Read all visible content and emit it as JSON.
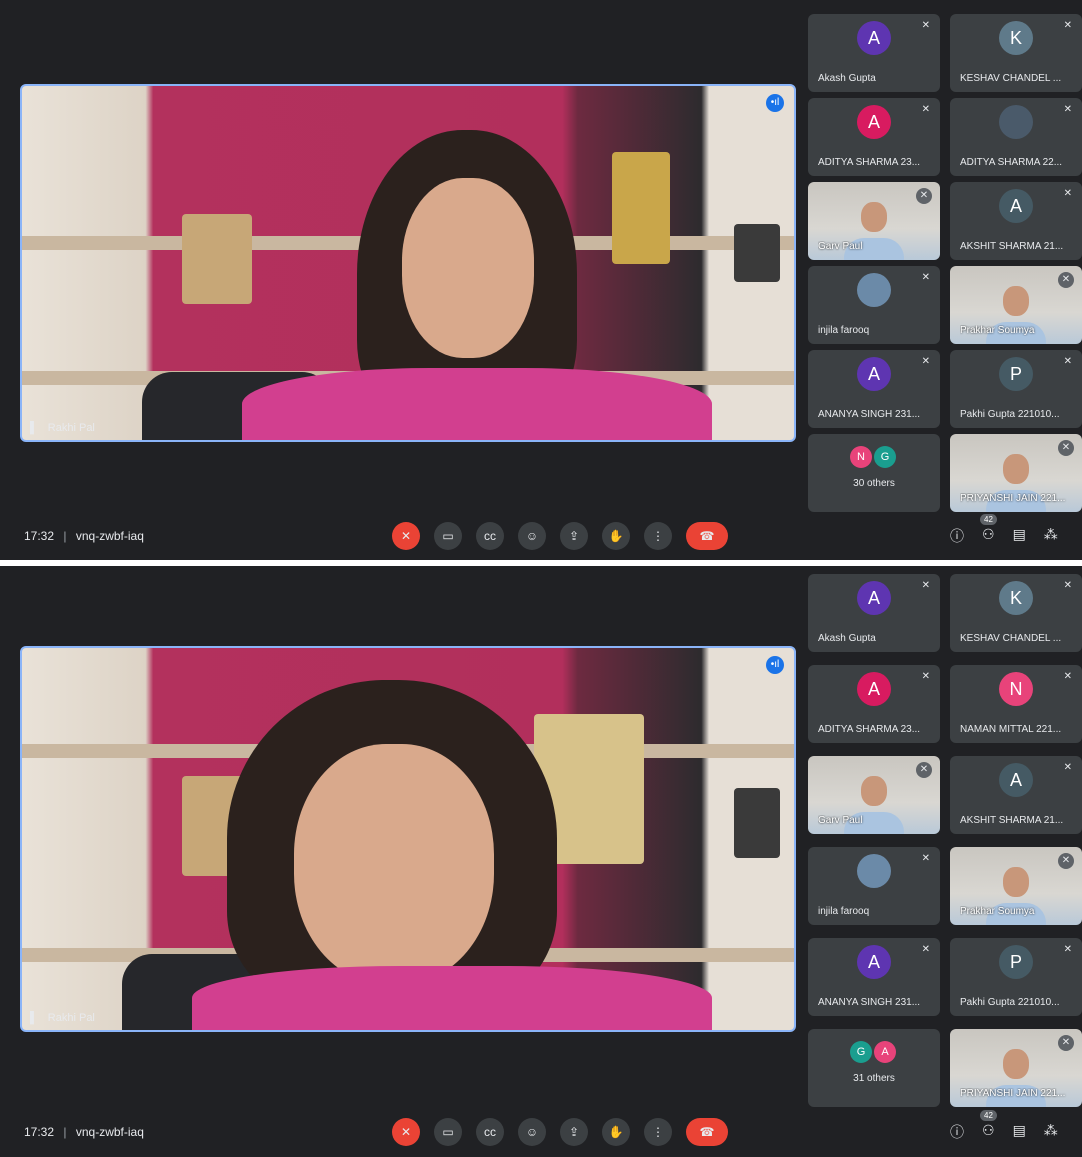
{
  "panels": [
    {
      "main": {
        "name": "Rakhi Pal"
      },
      "meeting": {
        "time": "17:32",
        "separator": "|",
        "code": "vnq-zwbf-iaq"
      },
      "participants_count": "42",
      "tiles": [
        {
          "name": "Akash Gupta",
          "initial": "A",
          "color": "#5e35b1",
          "type": "avatar"
        },
        {
          "name": "KESHAV CHANDEL ...",
          "initial": "K",
          "color": "#5f7a8a",
          "type": "avatar"
        },
        {
          "name": "ADITYA SHARMA 23...",
          "initial": "A",
          "color": "#d81b60",
          "type": "avatar"
        },
        {
          "name": "ADITYA SHARMA 22...",
          "initial": "",
          "color": "#4a5a6a",
          "type": "photo"
        },
        {
          "name": "Garv Paul",
          "initial": "",
          "color": "",
          "type": "video"
        },
        {
          "name": "AKSHIT SHARMA 21...",
          "initial": "A",
          "color": "#455a64",
          "type": "avatar"
        },
        {
          "name": "injila farooq",
          "initial": "",
          "color": "#6b8aa8",
          "type": "photo"
        },
        {
          "name": "Prakhar Soumya",
          "initial": "",
          "color": "",
          "type": "video"
        },
        {
          "name": "ANANYA SINGH 231...",
          "initial": "A",
          "color": "#5e35b1",
          "type": "avatar"
        },
        {
          "name": "Pakhi Gupta 221010...",
          "initial": "P",
          "color": "#455a64",
          "type": "avatar"
        },
        {
          "name": "30 others",
          "initial": "",
          "color": "",
          "type": "others",
          "m1": "N",
          "m1c": "#e8437a",
          "m2": "G",
          "m2c": "#1a9e8f"
        },
        {
          "name": "PRIYANSHI JAIN 221...",
          "initial": "",
          "color": "",
          "type": "video"
        }
      ]
    },
    {
      "main": {
        "name": "Rakhi Pal"
      },
      "meeting": {
        "time": "17:32",
        "separator": "|",
        "code": "vnq-zwbf-iaq"
      },
      "participants_count": "42",
      "tiles": [
        {
          "name": "Akash Gupta",
          "initial": "A",
          "color": "#5e35b1",
          "type": "avatar"
        },
        {
          "name": "KESHAV CHANDEL ...",
          "initial": "K",
          "color": "#5f7a8a",
          "type": "avatar"
        },
        {
          "name": "ADITYA SHARMA 23...",
          "initial": "A",
          "color": "#d81b60",
          "type": "avatar"
        },
        {
          "name": "NAMAN MITTAL 221...",
          "initial": "N",
          "color": "#e8437a",
          "type": "avatar"
        },
        {
          "name": "Garv Paul",
          "initial": "",
          "color": "",
          "type": "video"
        },
        {
          "name": "AKSHIT SHARMA 21...",
          "initial": "A",
          "color": "#455a64",
          "type": "avatar"
        },
        {
          "name": "injila farooq",
          "initial": "",
          "color": "#6b8aa8",
          "type": "photo"
        },
        {
          "name": "Prakhar Soumya",
          "initial": "",
          "color": "",
          "type": "video"
        },
        {
          "name": "ANANYA SINGH 231...",
          "initial": "A",
          "color": "#5e35b1",
          "type": "avatar"
        },
        {
          "name": "Pakhi Gupta 221010...",
          "initial": "P",
          "color": "#455a64",
          "type": "avatar"
        },
        {
          "name": "31 others",
          "initial": "",
          "color": "",
          "type": "others",
          "m1": "G",
          "m1c": "#1a9e8f",
          "m2": "A",
          "m2c": "#e8437a"
        },
        {
          "name": "PRIYANSHI JAIN 221...",
          "initial": "",
          "color": "",
          "type": "video"
        }
      ]
    }
  ],
  "icons": {
    "mic_off": "mic-off-icon",
    "camera": "camera-icon",
    "captions": "captions-icon",
    "emoji": "emoji-icon",
    "present": "present-icon",
    "hand": "raise-hand-icon",
    "more": "more-options-icon",
    "end": "end-call-icon",
    "info": "info-icon",
    "people": "people-icon",
    "chat": "chat-icon",
    "activities": "activities-icon"
  }
}
